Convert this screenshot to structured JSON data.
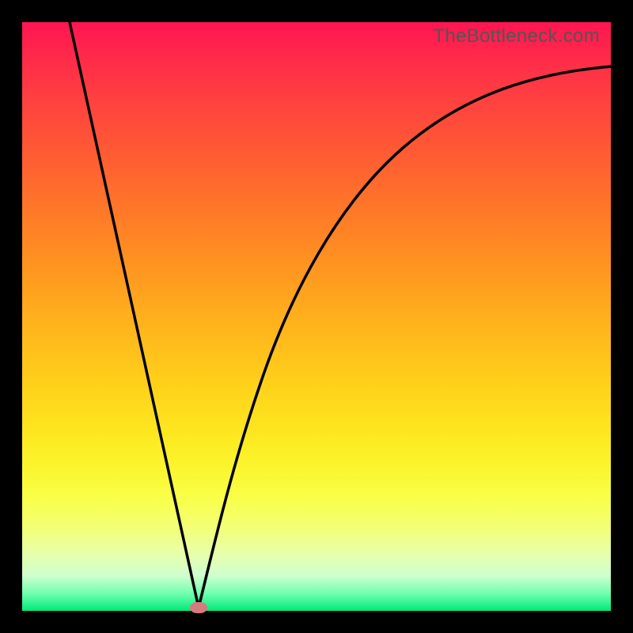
{
  "watermark": "TheBottleneck.com",
  "colors": {
    "frame": "#000000",
    "curve_stroke": "#000000",
    "marker_fill": "#d57a7d",
    "gradient_stops": [
      "#ff1552",
      "#ff2a4a",
      "#ff4040",
      "#ff5a34",
      "#ff7828",
      "#ff9620",
      "#ffb51c",
      "#ffd21a",
      "#fde820",
      "#fbf62f",
      "#f9ff4a",
      "#f3ff78",
      "#e9ffa8",
      "#cfffce",
      "#73ffb0",
      "#00e87a"
    ]
  },
  "chart_data": {
    "type": "line",
    "title": "",
    "xlabel": "",
    "ylabel": "",
    "xlim": [
      0,
      100
    ],
    "ylim": [
      0,
      100
    ],
    "grid": false,
    "series": [
      {
        "name": "left-branch",
        "x": [
          8,
          14,
          20,
          26,
          30
        ],
        "values": [
          100,
          73,
          46,
          19,
          0.5
        ]
      },
      {
        "name": "right-branch",
        "x": [
          30,
          34,
          38,
          44,
          52,
          62,
          74,
          88,
          100
        ],
        "values": [
          0.5,
          18,
          36,
          55,
          70,
          80,
          86.5,
          90.5,
          92.5
        ]
      }
    ],
    "marker": {
      "x": 30,
      "y": 0.5
    },
    "notes": "V-shaped black curve over vertical red-to-green gradient; minimum at marker."
  }
}
